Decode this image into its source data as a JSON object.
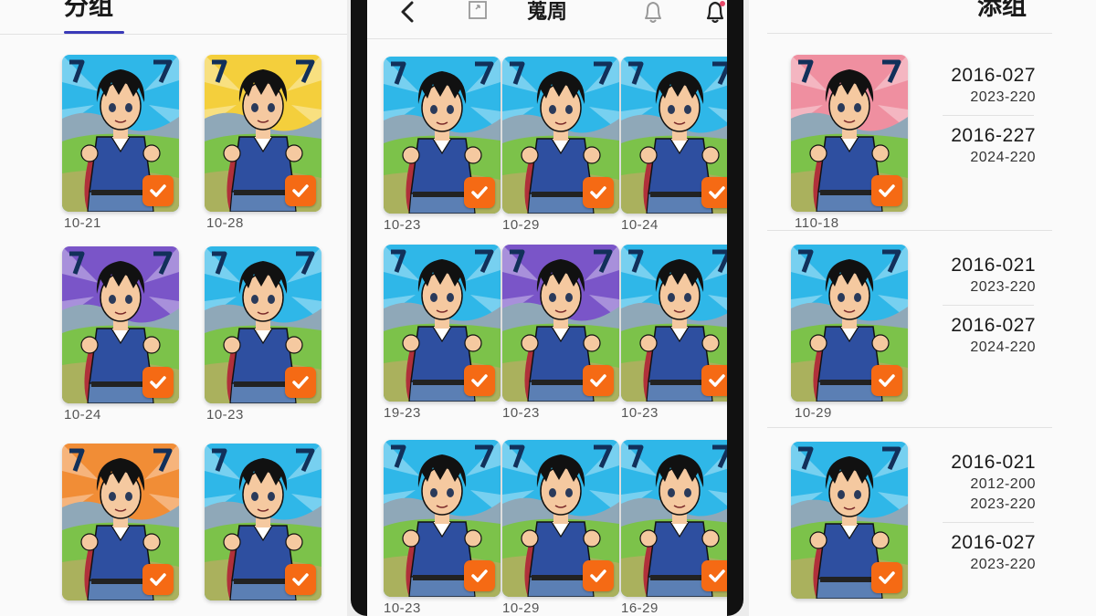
{
  "left": {
    "tab_label": "分组",
    "cards": [
      {
        "date": "10-21",
        "sky": "#2fb7e8",
        "checked": true
      },
      {
        "date": "10-28",
        "sky": "#f4cf3c",
        "checked": true
      },
      {
        "date": "10-24",
        "sky": "#7a55c8",
        "checked": true
      },
      {
        "date": "10-23",
        "sky": "#2fb7e8",
        "checked": true
      },
      {
        "date": "",
        "sky": "#f18d36",
        "checked": true
      },
      {
        "date": "",
        "sky": "#2fb7e8",
        "checked": true
      }
    ]
  },
  "center": {
    "title": "蒐周",
    "icons": [
      "back-arrow-icon",
      "crop-icon",
      "bell-icon",
      "bell-notification-icon"
    ],
    "cards": [
      {
        "date": "10-23",
        "sky": "#2fb7e8",
        "checked": true
      },
      {
        "date": "10-29",
        "sky": "#2fb7e8",
        "checked": true
      },
      {
        "date": "10-24",
        "sky": "#2fb7e8",
        "checked": true
      },
      {
        "date": "19-23",
        "sky": "#2fb7e8",
        "checked": true
      },
      {
        "date": "10-23",
        "sky": "#7a55c8",
        "checked": true
      },
      {
        "date": "10-23",
        "sky": "#2fb7e8",
        "checked": true
      },
      {
        "date": "10-23",
        "sky": "#2fb7e8",
        "checked": true
      },
      {
        "date": "10-29",
        "sky": "#2fb7e8",
        "checked": true
      },
      {
        "date": "16-29",
        "sky": "#2fb7e8",
        "checked": true
      }
    ]
  },
  "right": {
    "tab_label": "添组",
    "rows": [
      {
        "date": "110-18",
        "sky": "#ef8fa0",
        "checked": true,
        "groups": [
          {
            "main": "2016-027",
            "subs": [
              "2023-220"
            ]
          },
          {
            "main": "2016-227",
            "subs": [
              "2024-220"
            ]
          }
        ]
      },
      {
        "date": "10-29",
        "sky": "#2fb7e8",
        "checked": true,
        "groups": [
          {
            "main": "2016-021",
            "subs": [
              "2023-220"
            ]
          },
          {
            "main": "2016-027",
            "subs": [
              "2024-220"
            ]
          }
        ]
      },
      {
        "date": "",
        "sky": "#2fb7e8",
        "checked": true,
        "groups": [
          {
            "main": "2016-021",
            "subs": [
              "2012-200",
              "2023-220"
            ]
          },
          {
            "main": "2016-027",
            "subs": [
              "2023-220"
            ]
          }
        ]
      }
    ]
  },
  "colors": {
    "accent": "#3a3ab8",
    "check_badge": "#f56a14",
    "shirt": "#2e4fa0",
    "cape": "#b0303a",
    "grass": "#7cc24a"
  }
}
